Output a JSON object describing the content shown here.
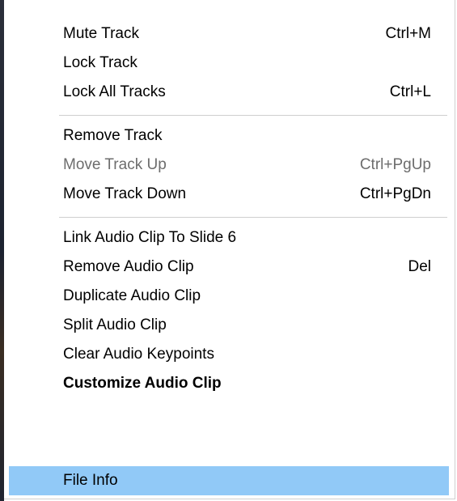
{
  "context_menu": {
    "items": [
      {
        "label": "Mute Track",
        "shortcut": "Ctrl+M"
      },
      {
        "label": "Lock Track",
        "shortcut": ""
      },
      {
        "label": "Lock All Tracks",
        "shortcut": "Ctrl+L"
      },
      {
        "label": "Remove Track",
        "shortcut": ""
      },
      {
        "label": "Move Track Up",
        "shortcut": "Ctrl+PgUp",
        "disabled": true
      },
      {
        "label": "Move Track Down",
        "shortcut": "Ctrl+PgDn"
      },
      {
        "label": "Link Audio Clip To Slide 6",
        "shortcut": ""
      },
      {
        "label": "Remove Audio Clip",
        "shortcut": "Del"
      },
      {
        "label": "Duplicate Audio Clip",
        "shortcut": ""
      },
      {
        "label": "Split Audio Clip",
        "shortcut": ""
      },
      {
        "label": "Clear Audio Keypoints",
        "shortcut": ""
      },
      {
        "label": "Customize Audio Clip",
        "shortcut": "",
        "bold": true
      },
      {
        "label": "File Info",
        "shortcut": "",
        "highlighted": true
      }
    ]
  },
  "colors": {
    "highlight": "#91c9f7",
    "disabled_text": "#6d6d6d",
    "separator": "#cfcfcf"
  }
}
